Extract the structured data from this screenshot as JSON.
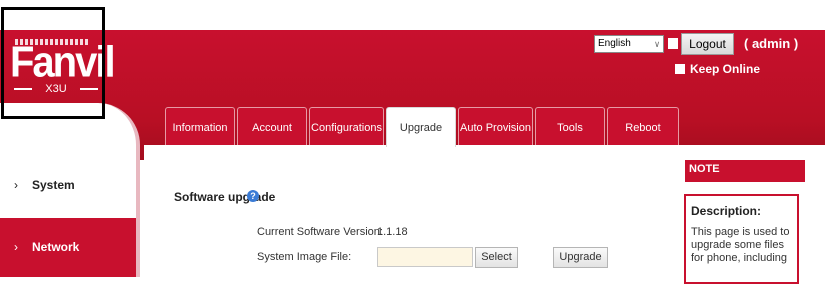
{
  "brand": {
    "logo": "Fanvil",
    "model": "X3U"
  },
  "header": {
    "language": "English",
    "logout_label": "Logout",
    "user_label": "( admin )",
    "keep_online_label": "Keep Online"
  },
  "tabs": [
    {
      "label": "Information"
    },
    {
      "label": "Account"
    },
    {
      "label": "Configurations"
    },
    {
      "label": "Upgrade",
      "active": true
    },
    {
      "label": "Auto Provision"
    },
    {
      "label": "Tools"
    },
    {
      "label": "Reboot Phone"
    }
  ],
  "sidebar": {
    "items": [
      {
        "label": "System",
        "active": true
      },
      {
        "label": "Network"
      }
    ]
  },
  "main": {
    "section_title": "Software upgrade",
    "current_version_label": "Current Software Version:",
    "current_version_value": "1.1.18",
    "image_file_label": "System Image File:",
    "image_file_value": "",
    "select_label": "Select",
    "upgrade_label": "Upgrade"
  },
  "note": {
    "heading": "NOTE",
    "desc_title": "Description:",
    "desc_text": "This page is used to upgrade some files for phone, including"
  },
  "colors": {
    "brand_red": "#c8102e",
    "help_blue": "#3a7bd5"
  },
  "icons": [
    "help-icon",
    "chevron-down-icon",
    "chevron-right-icon"
  ]
}
